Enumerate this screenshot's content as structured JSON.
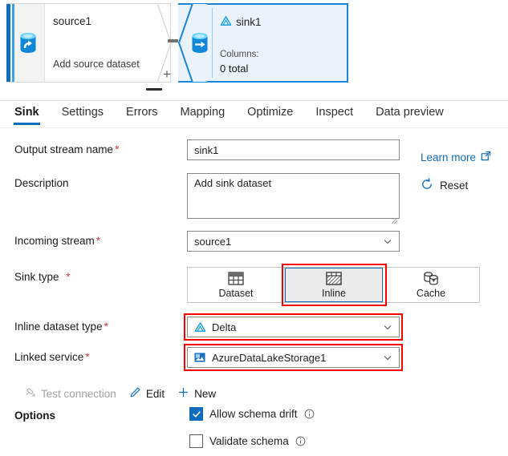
{
  "canvas": {
    "source_node": {
      "icon": "database-source-icon",
      "title": "source1",
      "subtitle": "Add source dataset"
    },
    "plus_button_label": "+",
    "sink_node": {
      "badge_icon": "database-sink-icon",
      "type_icon": "delta-lake-icon",
      "title": "sink1",
      "columns_label": "Columns:",
      "columns_value": "0 total"
    }
  },
  "tabs": [
    {
      "label": "Sink",
      "active": true
    },
    {
      "label": "Settings",
      "active": false
    },
    {
      "label": "Errors",
      "active": false
    },
    {
      "label": "Mapping",
      "active": false
    },
    {
      "label": "Optimize",
      "active": false
    },
    {
      "label": "Inspect",
      "active": false
    },
    {
      "label": "Data preview",
      "active": false
    }
  ],
  "form": {
    "output_stream_name": {
      "label": "Output stream name",
      "required": "*",
      "value": "sink1"
    },
    "description": {
      "label": "Description",
      "value": "Add sink dataset"
    },
    "incoming_stream": {
      "label": "Incoming stream",
      "required": "*",
      "value": "source1"
    },
    "sink_type": {
      "label": "Sink type",
      "required": "*",
      "options": [
        {
          "label": "Dataset",
          "icon": "table-grid-icon",
          "selected": false
        },
        {
          "label": "Inline",
          "icon": "inline-hatch-icon",
          "selected": true
        },
        {
          "label": "Cache",
          "icon": "cache-cylinders-icon",
          "selected": false
        }
      ]
    },
    "inline_dataset_type": {
      "label": "Inline dataset type",
      "required": "*",
      "value": "Delta",
      "icon": "delta-lake-icon"
    },
    "linked_service": {
      "label": "Linked service",
      "required": "*",
      "value": "AzureDataLakeStorage1",
      "icon": "azure-data-lake-icon"
    }
  },
  "side_actions": {
    "learn_more": "Learn more",
    "learn_more_icon": "external-link-icon",
    "reset": "Reset",
    "reset_icon": "refresh-circle-icon"
  },
  "link_toolbar": [
    {
      "label": "Test connection",
      "icon": "plug-connection-icon",
      "disabled": true
    },
    {
      "label": "Edit",
      "icon": "pencil-edit-icon",
      "disabled": false
    },
    {
      "label": "New",
      "icon": "plus-icon",
      "disabled": false
    }
  ],
  "options": {
    "label": "Options",
    "items": [
      {
        "label": "Allow schema drift",
        "checked": true,
        "info_icon": "info-circle-icon"
      },
      {
        "label": "Validate schema",
        "checked": false,
        "info_icon": "info-circle-icon"
      }
    ]
  },
  "colors": {
    "accent": "#0f6cbd",
    "annotation": "#ff0000",
    "required": "#d13438",
    "sink_panel_bg": "#eaf3fb",
    "sink_border": "#1a86d9"
  }
}
